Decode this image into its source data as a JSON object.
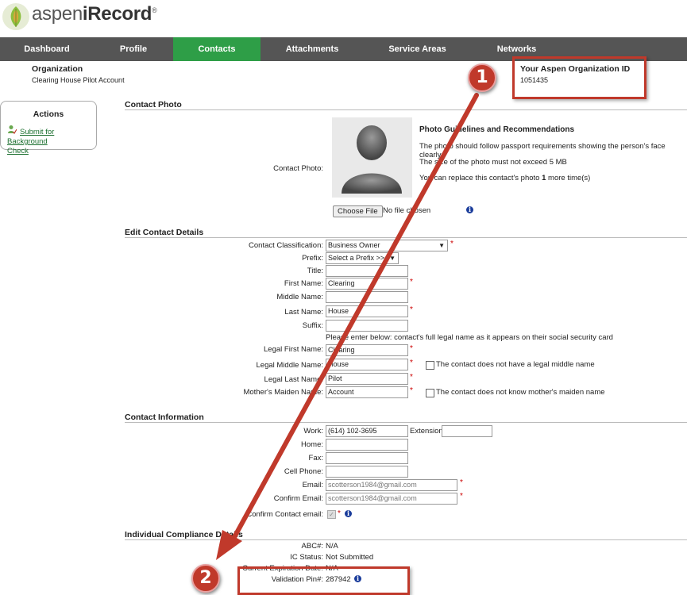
{
  "header": {
    "logo_prefix": "aspen",
    "logo_main": "iRecord",
    "logo_reg": "®"
  },
  "nav": [
    "Dashboard",
    "Profile",
    "Contacts",
    "Attachments",
    "Service Areas",
    "Networks"
  ],
  "organization": {
    "label": "Organization",
    "name": "Clearing House Pilot Account"
  },
  "org_id": {
    "label": "Your Aspen Organization ID",
    "value": "1051435"
  },
  "actions": {
    "title": "Actions",
    "link": "Submit for Background",
    "link2": "Check"
  },
  "photo": {
    "section": "Contact Photo",
    "label": "Contact Photo:",
    "guidelines_title": "Photo Guidelines and Recommendations",
    "line1": "The photo should follow passport requirements showing the person's face clearly.",
    "line2": "The size of the photo must not exceed 5 MB",
    "line3_pre": "You can replace this contact's photo ",
    "line3_num": "1",
    "line3_post": " more time(s)",
    "choose_file": "Choose File",
    "no_file": "No file chosen"
  },
  "details": {
    "section": "Edit Contact Details",
    "classification_label": "Contact Classification:",
    "classification_value": "Business Owner",
    "prefix_label": "Prefix:",
    "prefix_value": "Select a Prefix >>",
    "title_label": "Title:",
    "first_label": "First Name:",
    "first_value": "Clearing",
    "middle_label": "Middle Name:",
    "last_label": "Last Name:",
    "last_value": "House",
    "suffix_label": "Suffix:",
    "legal_note": "Please enter below: contact's full legal name as it appears on their social security card",
    "legal_first_label": "Legal First Name:",
    "legal_first_value": "Clearing",
    "legal_middle_label": "Legal Middle Name:",
    "legal_middle_value": "House",
    "legal_middle_check": "The contact does not have a legal middle name",
    "legal_last_label": "Legal Last Name:",
    "legal_last_value": "Pilot",
    "maiden_label": "Mother's Maiden Name:",
    "maiden_value": "Account",
    "maiden_check": "The contact does not know mother's maiden name"
  },
  "contact": {
    "section": "Contact Information",
    "work_label": "Work:",
    "work_value": "(614) 102-3695",
    "ext_label": "Extension:",
    "home_label": "Home:",
    "fax_label": "Fax:",
    "cell_label": "Cell Phone:",
    "email_label": "Email:",
    "email_value": "scotterson1984@gmail.com",
    "confirm_email_label": "Confirm Email:",
    "confirm_email_value": "scotterson1984@gmail.com",
    "confirm_contact_label": "Confirm Contact email:"
  },
  "compliance": {
    "section": "Individual Compliance Details",
    "abc_label": "ABC#:",
    "abc_value": "N/A",
    "ic_label": "IC Status:",
    "ic_value": "Not Submitted",
    "exp_label": "Current Expiration Date:",
    "exp_value": "N/A",
    "pin_label": "Validation Pin#:",
    "pin_value": "287942"
  },
  "callouts": [
    "1",
    "2"
  ],
  "colors": {
    "accent": "#2e9e47",
    "nav_bg": "#555555",
    "annotation": "#c0392b"
  }
}
